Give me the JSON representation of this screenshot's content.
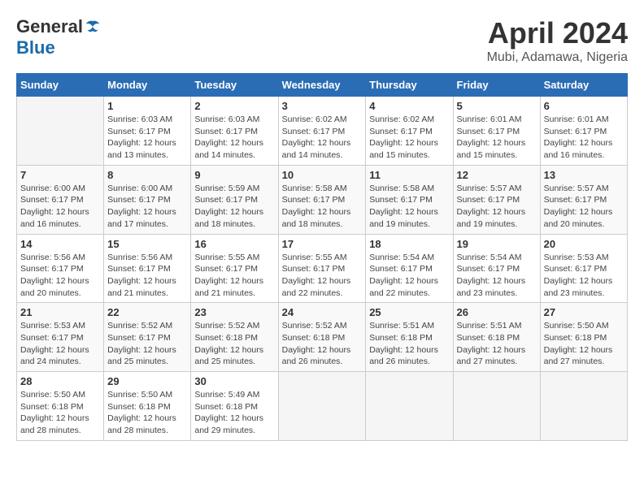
{
  "logo": {
    "general": "General",
    "blue": "Blue"
  },
  "title": {
    "month": "April 2024",
    "location": "Mubi, Adamawa, Nigeria"
  },
  "weekdays": [
    "Sunday",
    "Monday",
    "Tuesday",
    "Wednesday",
    "Thursday",
    "Friday",
    "Saturday"
  ],
  "weeks": [
    [
      {
        "day": "",
        "sunrise": "",
        "sunset": "",
        "daylight": ""
      },
      {
        "day": "1",
        "sunrise": "Sunrise: 6:03 AM",
        "sunset": "Sunset: 6:17 PM",
        "daylight": "Daylight: 12 hours and 13 minutes."
      },
      {
        "day": "2",
        "sunrise": "Sunrise: 6:03 AM",
        "sunset": "Sunset: 6:17 PM",
        "daylight": "Daylight: 12 hours and 14 minutes."
      },
      {
        "day": "3",
        "sunrise": "Sunrise: 6:02 AM",
        "sunset": "Sunset: 6:17 PM",
        "daylight": "Daylight: 12 hours and 14 minutes."
      },
      {
        "day": "4",
        "sunrise": "Sunrise: 6:02 AM",
        "sunset": "Sunset: 6:17 PM",
        "daylight": "Daylight: 12 hours and 15 minutes."
      },
      {
        "day": "5",
        "sunrise": "Sunrise: 6:01 AM",
        "sunset": "Sunset: 6:17 PM",
        "daylight": "Daylight: 12 hours and 15 minutes."
      },
      {
        "day": "6",
        "sunrise": "Sunrise: 6:01 AM",
        "sunset": "Sunset: 6:17 PM",
        "daylight": "Daylight: 12 hours and 16 minutes."
      }
    ],
    [
      {
        "day": "7",
        "sunrise": "Sunrise: 6:00 AM",
        "sunset": "Sunset: 6:17 PM",
        "daylight": "Daylight: 12 hours and 16 minutes."
      },
      {
        "day": "8",
        "sunrise": "Sunrise: 6:00 AM",
        "sunset": "Sunset: 6:17 PM",
        "daylight": "Daylight: 12 hours and 17 minutes."
      },
      {
        "day": "9",
        "sunrise": "Sunrise: 5:59 AM",
        "sunset": "Sunset: 6:17 PM",
        "daylight": "Daylight: 12 hours and 18 minutes."
      },
      {
        "day": "10",
        "sunrise": "Sunrise: 5:58 AM",
        "sunset": "Sunset: 6:17 PM",
        "daylight": "Daylight: 12 hours and 18 minutes."
      },
      {
        "day": "11",
        "sunrise": "Sunrise: 5:58 AM",
        "sunset": "Sunset: 6:17 PM",
        "daylight": "Daylight: 12 hours and 19 minutes."
      },
      {
        "day": "12",
        "sunrise": "Sunrise: 5:57 AM",
        "sunset": "Sunset: 6:17 PM",
        "daylight": "Daylight: 12 hours and 19 minutes."
      },
      {
        "day": "13",
        "sunrise": "Sunrise: 5:57 AM",
        "sunset": "Sunset: 6:17 PM",
        "daylight": "Daylight: 12 hours and 20 minutes."
      }
    ],
    [
      {
        "day": "14",
        "sunrise": "Sunrise: 5:56 AM",
        "sunset": "Sunset: 6:17 PM",
        "daylight": "Daylight: 12 hours and 20 minutes."
      },
      {
        "day": "15",
        "sunrise": "Sunrise: 5:56 AM",
        "sunset": "Sunset: 6:17 PM",
        "daylight": "Daylight: 12 hours and 21 minutes."
      },
      {
        "day": "16",
        "sunrise": "Sunrise: 5:55 AM",
        "sunset": "Sunset: 6:17 PM",
        "daylight": "Daylight: 12 hours and 21 minutes."
      },
      {
        "day": "17",
        "sunrise": "Sunrise: 5:55 AM",
        "sunset": "Sunset: 6:17 PM",
        "daylight": "Daylight: 12 hours and 22 minutes."
      },
      {
        "day": "18",
        "sunrise": "Sunrise: 5:54 AM",
        "sunset": "Sunset: 6:17 PM",
        "daylight": "Daylight: 12 hours and 22 minutes."
      },
      {
        "day": "19",
        "sunrise": "Sunrise: 5:54 AM",
        "sunset": "Sunset: 6:17 PM",
        "daylight": "Daylight: 12 hours and 23 minutes."
      },
      {
        "day": "20",
        "sunrise": "Sunrise: 5:53 AM",
        "sunset": "Sunset: 6:17 PM",
        "daylight": "Daylight: 12 hours and 23 minutes."
      }
    ],
    [
      {
        "day": "21",
        "sunrise": "Sunrise: 5:53 AM",
        "sunset": "Sunset: 6:17 PM",
        "daylight": "Daylight: 12 hours and 24 minutes."
      },
      {
        "day": "22",
        "sunrise": "Sunrise: 5:52 AM",
        "sunset": "Sunset: 6:17 PM",
        "daylight": "Daylight: 12 hours and 25 minutes."
      },
      {
        "day": "23",
        "sunrise": "Sunrise: 5:52 AM",
        "sunset": "Sunset: 6:18 PM",
        "daylight": "Daylight: 12 hours and 25 minutes."
      },
      {
        "day": "24",
        "sunrise": "Sunrise: 5:52 AM",
        "sunset": "Sunset: 6:18 PM",
        "daylight": "Daylight: 12 hours and 26 minutes."
      },
      {
        "day": "25",
        "sunrise": "Sunrise: 5:51 AM",
        "sunset": "Sunset: 6:18 PM",
        "daylight": "Daylight: 12 hours and 26 minutes."
      },
      {
        "day": "26",
        "sunrise": "Sunrise: 5:51 AM",
        "sunset": "Sunset: 6:18 PM",
        "daylight": "Daylight: 12 hours and 27 minutes."
      },
      {
        "day": "27",
        "sunrise": "Sunrise: 5:50 AM",
        "sunset": "Sunset: 6:18 PM",
        "daylight": "Daylight: 12 hours and 27 minutes."
      }
    ],
    [
      {
        "day": "28",
        "sunrise": "Sunrise: 5:50 AM",
        "sunset": "Sunset: 6:18 PM",
        "daylight": "Daylight: 12 hours and 28 minutes."
      },
      {
        "day": "29",
        "sunrise": "Sunrise: 5:50 AM",
        "sunset": "Sunset: 6:18 PM",
        "daylight": "Daylight: 12 hours and 28 minutes."
      },
      {
        "day": "30",
        "sunrise": "Sunrise: 5:49 AM",
        "sunset": "Sunset: 6:18 PM",
        "daylight": "Daylight: 12 hours and 29 minutes."
      },
      {
        "day": "",
        "sunrise": "",
        "sunset": "",
        "daylight": ""
      },
      {
        "day": "",
        "sunrise": "",
        "sunset": "",
        "daylight": ""
      },
      {
        "day": "",
        "sunrise": "",
        "sunset": "",
        "daylight": ""
      },
      {
        "day": "",
        "sunrise": "",
        "sunset": "",
        "daylight": ""
      }
    ]
  ]
}
